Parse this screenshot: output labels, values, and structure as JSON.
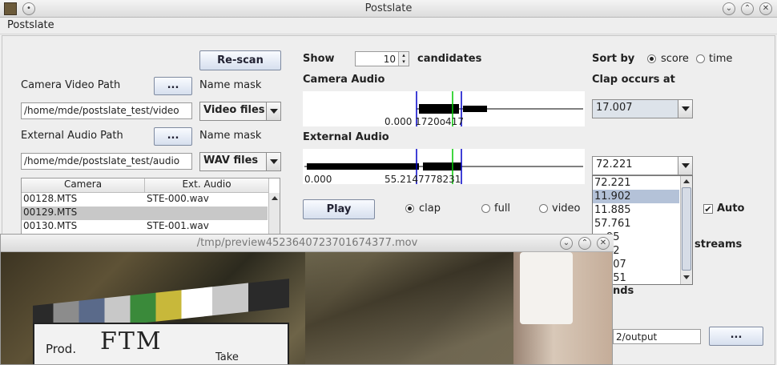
{
  "window": {
    "title": "Postslate"
  },
  "menu": {
    "items": [
      "Postslate"
    ]
  },
  "rescan_label": "Re-scan",
  "camera": {
    "path_label": "Camera Video Path",
    "browse_label": "...",
    "name_mask_label": "Name mask",
    "path_value": "/home/mde/postslate_test/video",
    "mask_value": "Video files"
  },
  "audio": {
    "path_label": "External Audio Path",
    "browse_label": "...",
    "name_mask_label": "Name mask",
    "path_value": "/home/mde/postslate_test/audio",
    "mask_value": "WAV files"
  },
  "table": {
    "headers": [
      "Camera",
      "Ext. Audio"
    ],
    "rows": [
      [
        "00128.MTS",
        "STE-000.wav"
      ],
      [
        "00129.MTS",
        ""
      ],
      [
        "00130.MTS",
        "STE-001.wav"
      ]
    ]
  },
  "show": {
    "label": "Show",
    "value": "10",
    "suffix": "candidates"
  },
  "camera_audio": {
    "label": "Camera Audio",
    "ticks": [
      "0.000",
      "17.007",
      "18.417"
    ],
    "overlap_text": "0.000 1720o417"
  },
  "external_audio": {
    "label": "External Audio",
    "ticks": [
      "0.000",
      "55.214",
      "72.221"
    ],
    "overlap_text": "55.2147778231"
  },
  "play_label": "Play",
  "modes": {
    "clap": "clap",
    "full": "full",
    "video": "video"
  },
  "sort": {
    "label": "Sort by",
    "score": "score",
    "time": "time"
  },
  "clap": {
    "label": "Clap occurs at",
    "camera_value": "17.007",
    "audio_value": "72.221",
    "list": [
      "72.221",
      "11.902",
      "11.885",
      "57.761",
      "95",
      "62",
      "907",
      "851"
    ],
    "list_visible": [
      "72.221",
      "11.902",
      "11.885",
      "57.761",
      "..195",
      "..62",
      "..907",
      "..851"
    ]
  },
  "auto_label": "Auto",
  "streams_label": "streams",
  "seconds_partial": "nds",
  "output_partial": "2/output",
  "output_browse": "...",
  "preview": {
    "title": "/tmp/preview4523640723701674377.mov",
    "slate_text": "FTM",
    "slate_prod": "Prod.",
    "slate_take": "Take"
  },
  "colors": {
    "selected_row": "#c8c8c8",
    "list_highlight": "#b4c2d8",
    "clap_marker": "#00c800",
    "window_marker": "#0000c8"
  }
}
